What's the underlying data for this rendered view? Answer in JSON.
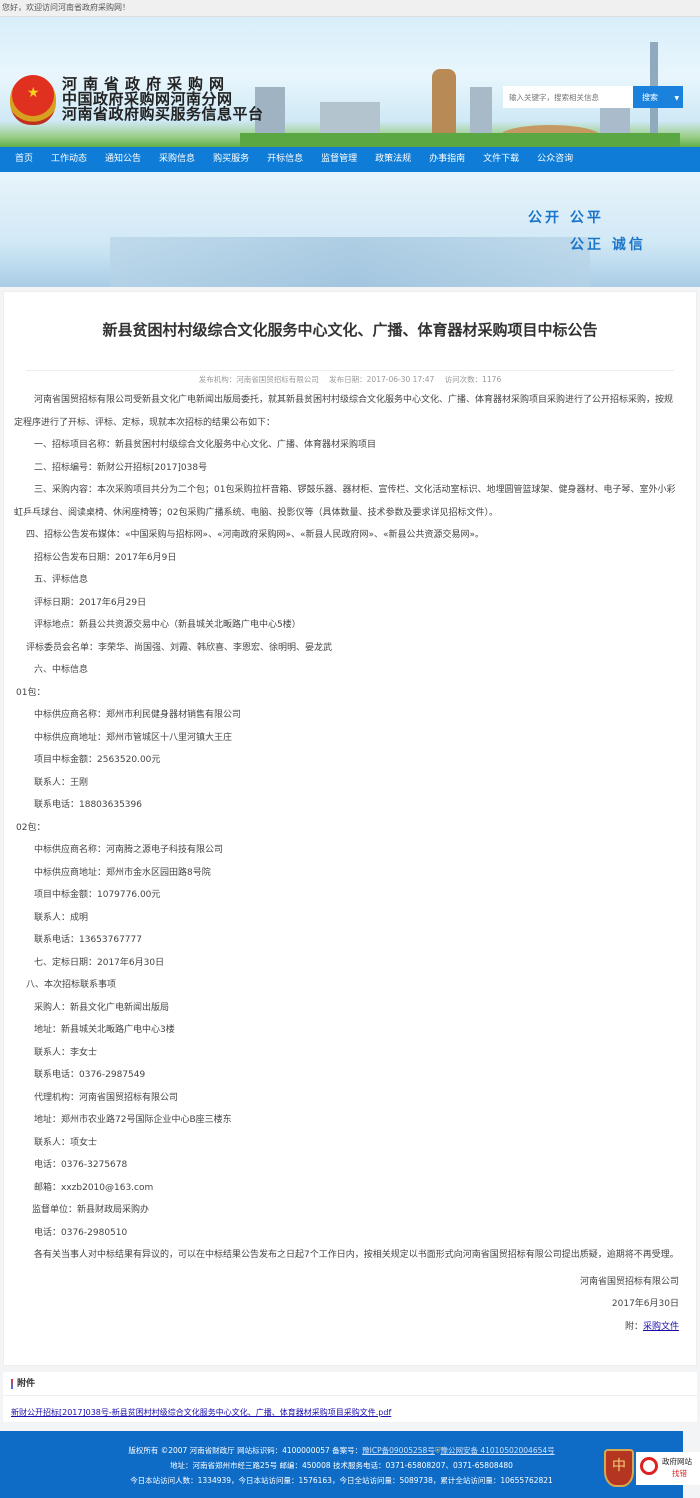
{
  "topbar": {
    "welcome": "您好，欢迎访问河南省政府采购网！"
  },
  "header": {
    "logo_lines": [
      "河南省政府采购网",
      "中国政府采购网河南分网",
      "河南省政府购买服务信息平台"
    ],
    "search_placeholder": "输入关键字，搜索相关信息",
    "search_button": "搜索"
  },
  "nav": [
    "首页",
    "工作动态",
    "通知公告",
    "采购信息",
    "购买服务",
    "开标信息",
    "监督管理",
    "政策法规",
    "办事指南",
    "文件下载",
    "公众咨询"
  ],
  "banner": {
    "slogan1": "公开  公平",
    "slogan2": "公正  诚信"
  },
  "article": {
    "title": "新县贫困村村级综合文化服务中心文化、广播、体育器材采购项目中标公告",
    "meta": {
      "org": "发布机构：河南省国贸招标有限公司",
      "date": "发布日期：2017-06-30 17:47",
      "visits": "访问次数：1176"
    },
    "paragraphs": [
      "河南省国贸招标有限公司受新县文化广电新闻出版局委托，就其新县贫困村村级综合文化服务中心文化、广播、体育器材采购项目采购进行了公开招标采购，按规定程序进行了开标、评标、定标，现就本次招标的结果公布如下：",
      "一、招标项目名称：新县贫困村村级综合文化服务中心文化、广播、体育器材采购项目",
      "二、招标编号：新财公开招标[2017]038号",
      "三、采购内容：本次采购项目共分为二个包；01包采购拉杆音箱、锣鼓乐器、器材柜、宣传栏、文化活动室标识、地埋圆管篮球架、健身器材、电子琴、室外小彩虹乒乓球台、阅读桌椅、休闲座椅等；02包采购广播系统、电脑、投影仪等（具体数量、技术参数及要求详见招标文件）。",
      "四、招标公告发布媒体：«中国采购与招标网»、«河南政府采购网»、«新县人民政府网»、«新县公共资源交易网»。",
      "招标公告发布日期：2017年6月9日",
      "五、评标信息",
      "评标日期：2017年6月29日",
      "评标地点：新县公共资源交易中心（新县城关北畈路广电中心5楼）",
      "评标委员会名单：李荣华、尚国强、刘霞、韩欣喜、李恩宏、徐明明、晏龙武",
      "六、中标信息",
      "01包：",
      "中标供应商名称：郑州市利民健身器材销售有限公司",
      "中标供应商地址：郑州市管城区十八里河镇大王庄",
      "项目中标金额：2563520.00元",
      "联系人：王刚",
      "联系电话：18803635396",
      "02包：",
      "中标供应商名称：河南腾之源电子科技有限公司",
      "中标供应商地址：郑州市金水区园田路8号院",
      "项目中标金额：1079776.00元",
      "联系人：成明",
      "联系电话：13653767777",
      "七、定标日期：2017年6月30日",
      "八、本次招标联系事项",
      "采购人：新县文化广电新闻出版局",
      "地址：新县城关北畈路广电中心3楼",
      "联系人：李女士",
      "联系电话：0376-2987549",
      "代理机构：河南省国贸招标有限公司",
      "地址：郑州市农业路72号国际企业中心B座三楼东",
      "联系人：项女士",
      "电话：0376-3275678",
      "邮箱：xxzb2010@163.com",
      "监督单位：新县财政局采购办",
      "电话：0376-2980510",
      "各有关当事人对中标结果有异议的，可以在中标结果公告发布之日起7个工作日内，按相关规定以书面形式向河南省国贸招标有限公司提出质疑，逾期将不再受理。"
    ],
    "signature": "河南省国贸招标有限公司",
    "sign_date": "2017年6月30日",
    "attach_label": "附：",
    "attach_link": "采购文件"
  },
  "attachments": {
    "heading": "附件",
    "file": "新财公开招标[2017]038号-新县贫困村村级综合文化服务中心文化、广播、体育器材采购项目采购文件.pdf"
  },
  "footer": {
    "line1_prefix": "版权所有 ©2007 河南省财政厅 网站标识码：4100000057 备案号：",
    "icp": "豫ICP备09005258号",
    "police": "豫公网安备 41010502004654号",
    "line2": "地址：河南省郑州市经三路25号 邮编：450008 技术服务电话：0371-65808207、0371-65808480",
    "line3": "今日本站访问人数：1334939，今日本站访问量：1576163，今日全站访问量：5089738，累计全站访问量：10655762821",
    "badge_text": "政府网站",
    "badge_sub": "找错",
    "badge1": "党政机关"
  },
  "colors": {
    "nav": "#0f7dd8",
    "footer": "#0e6cc7",
    "link": "#1a0dab"
  }
}
